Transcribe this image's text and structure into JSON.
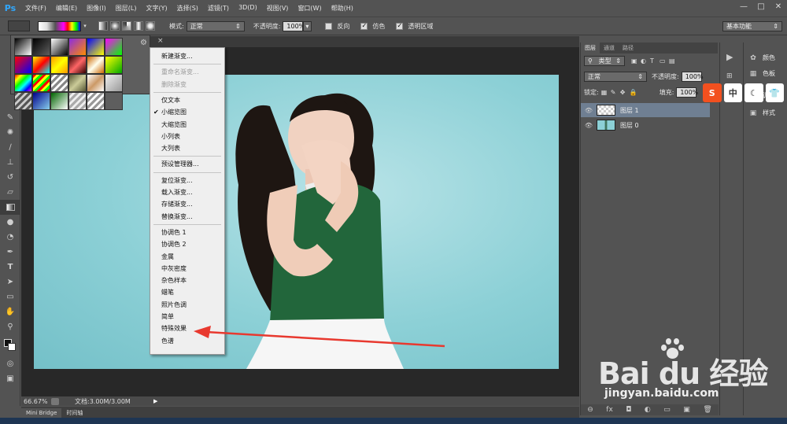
{
  "app": {
    "logo": "Ps"
  },
  "menubar": {
    "items": [
      "文件(F)",
      "编辑(E)",
      "图像(I)",
      "图层(L)",
      "文字(Y)",
      "选择(S)",
      "滤镜(T)",
      "3D(D)",
      "视图(V)",
      "窗口(W)",
      "帮助(H)"
    ],
    "window_controls": [
      "—",
      "□",
      "✕"
    ]
  },
  "options": {
    "mode_label": "模式:",
    "mode_value": "正常",
    "opacity_label": "不透明度:",
    "opacity_value": "100%",
    "reverse_label": "反向",
    "dither_label": "仿色",
    "transparency_label": "透明区域",
    "workspace": "基本功能"
  },
  "gradient_menu": {
    "items": [
      {
        "label": "新建渐变...",
        "enabled": true
      },
      {
        "sep": true
      },
      {
        "label": "重命名渐变...",
        "enabled": false
      },
      {
        "label": "删除渐变",
        "enabled": false
      },
      {
        "sep": true
      },
      {
        "label": "仅文本",
        "enabled": true
      },
      {
        "label": "小缩览图",
        "enabled": true,
        "checked": true
      },
      {
        "label": "大缩览图",
        "enabled": true
      },
      {
        "label": "小列表",
        "enabled": true
      },
      {
        "label": "大列表",
        "enabled": true
      },
      {
        "sep": true
      },
      {
        "label": "预设管理器...",
        "enabled": true
      },
      {
        "sep": true
      },
      {
        "label": "复位渐变...",
        "enabled": true
      },
      {
        "label": "载入渐变...",
        "enabled": true
      },
      {
        "label": "存储渐变...",
        "enabled": true
      },
      {
        "label": "替换渐变...",
        "enabled": true
      },
      {
        "sep": true
      },
      {
        "label": "协调色 1",
        "enabled": true
      },
      {
        "label": "协调色 2",
        "enabled": true
      },
      {
        "label": "金属",
        "enabled": true
      },
      {
        "label": "中灰密度",
        "enabled": true
      },
      {
        "label": "杂色样本",
        "enabled": true
      },
      {
        "label": "蜡笔",
        "enabled": true
      },
      {
        "label": "照片色调",
        "enabled": true
      },
      {
        "label": "简单",
        "enabled": true
      },
      {
        "label": "特殊效果",
        "enabled": true
      },
      {
        "label": "色谱",
        "enabled": true
      }
    ]
  },
  "status": {
    "zoom": "66.67%",
    "doc": "文档:3.00M/3.00M"
  },
  "bottom_tabs": [
    "Mini Bridge",
    "时间轴"
  ],
  "layers": {
    "tabs": [
      "图层",
      "通道",
      "路径"
    ],
    "filter": "类型",
    "blend_mode": "正常",
    "opacity_label": "不透明度:",
    "opacity_value": "100%",
    "lock_label": "锁定:",
    "fill_label": "填充:",
    "fill_value": "100%",
    "list": [
      {
        "name": "图层 1",
        "selected": true
      },
      {
        "name": "图层 0",
        "selected": false
      }
    ],
    "footer_icons": [
      "link-icon",
      "fx-icon",
      "mask-icon",
      "adjustment-icon",
      "folder-icon",
      "new-layer-icon",
      "trash-icon"
    ],
    "footer_glyphs": [
      "⊖",
      "fx",
      "◘",
      "◐",
      "▭",
      "▣",
      "🗑"
    ]
  },
  "side_panel": {
    "items": [
      {
        "label": "颜色",
        "icon": "palette-icon"
      },
      {
        "label": "色板",
        "icon": "swatches-icon"
      },
      {
        "label": "调整",
        "icon": "adjust-icon"
      },
      {
        "label": "样式",
        "icon": "style-icon"
      }
    ]
  },
  "ime": {
    "buttons": [
      "S",
      "中",
      "☾",
      "👕"
    ]
  },
  "watermark": {
    "brand": "Bai du 经验",
    "url": "jingyan.baidu.com"
  },
  "colors": {
    "arrow": "#e8392f",
    "accent": "#31a8ff"
  }
}
